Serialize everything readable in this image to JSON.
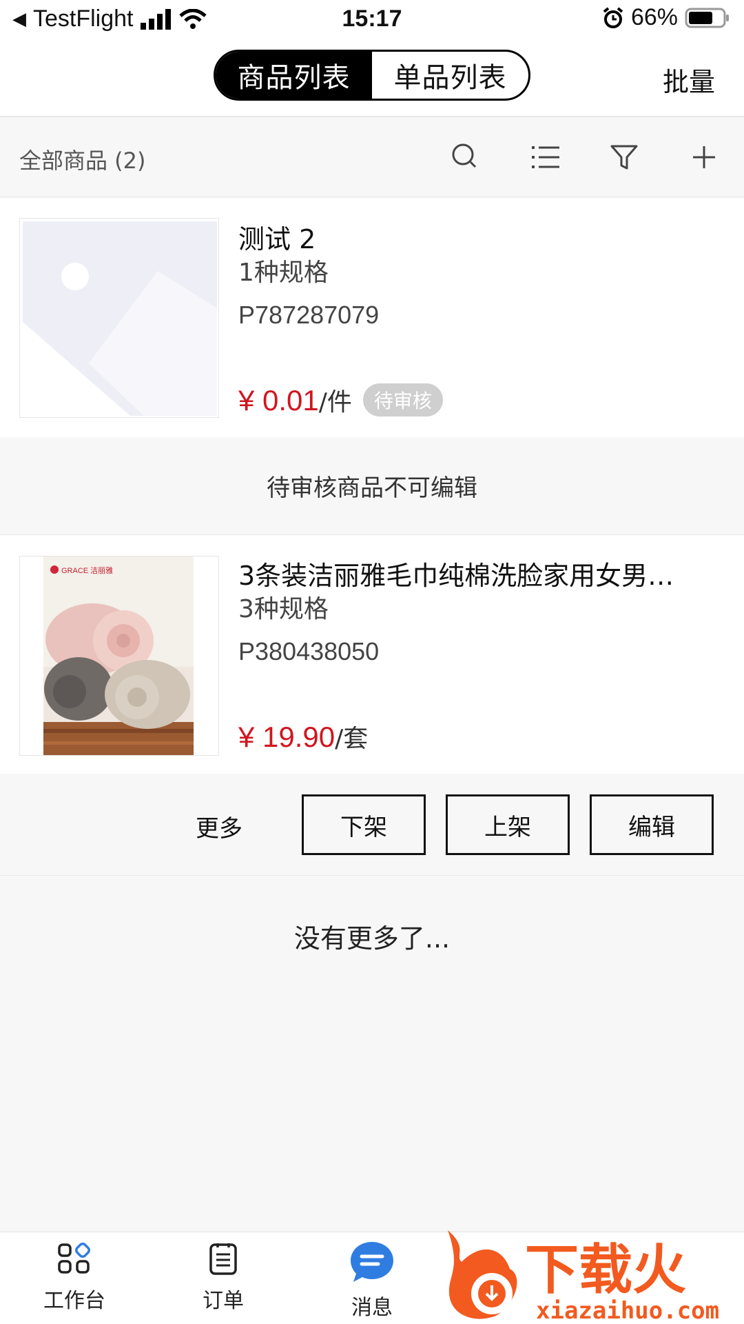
{
  "status_bar": {
    "back_app": "TestFlight",
    "time": "15:17",
    "battery": "66%"
  },
  "header": {
    "tabs": [
      {
        "label": "商品列表",
        "active": true
      },
      {
        "label": "单品列表",
        "active": false
      }
    ],
    "batch_label": "批量"
  },
  "toolbar": {
    "count_label": "全部商品 (2)",
    "icons": [
      "search-icon",
      "list-icon",
      "filter-icon",
      "add-icon"
    ]
  },
  "products": [
    {
      "title": "测试 2",
      "spec": "1种规格",
      "code": "P787287079",
      "price": "¥ 0.01",
      "unit": "/件",
      "badge": "待审核",
      "image": "placeholder-image"
    },
    {
      "title": "3条装洁丽雅毛巾纯棉洗脸家用女男…",
      "spec": "3种规格",
      "code": "P380438050",
      "price": "¥ 19.90",
      "unit": "/套",
      "image": "towel-photo",
      "image_brand_text": "GRACE 洁丽雅"
    }
  ],
  "notice": "待审核商品不可编辑",
  "actions": {
    "more": "更多",
    "off_shelf": "下架",
    "on_shelf": "上架",
    "edit": "编辑"
  },
  "end_text": "没有更多了...",
  "tabbar": {
    "items": [
      {
        "label": "工作台",
        "icon": "dashboard-icon"
      },
      {
        "label": "订单",
        "icon": "order-icon"
      },
      {
        "label": "消息",
        "icon": "message-icon"
      }
    ]
  },
  "watermark": {
    "brand": "下载火",
    "url": "xiazaihuo.com"
  },
  "colors": {
    "price_red": "#d0161f",
    "badge_gray": "#cfcfcf",
    "background": "#f7f7f7",
    "message_blue": "#2f7de1",
    "watermark_orange": "#f25a1f"
  }
}
